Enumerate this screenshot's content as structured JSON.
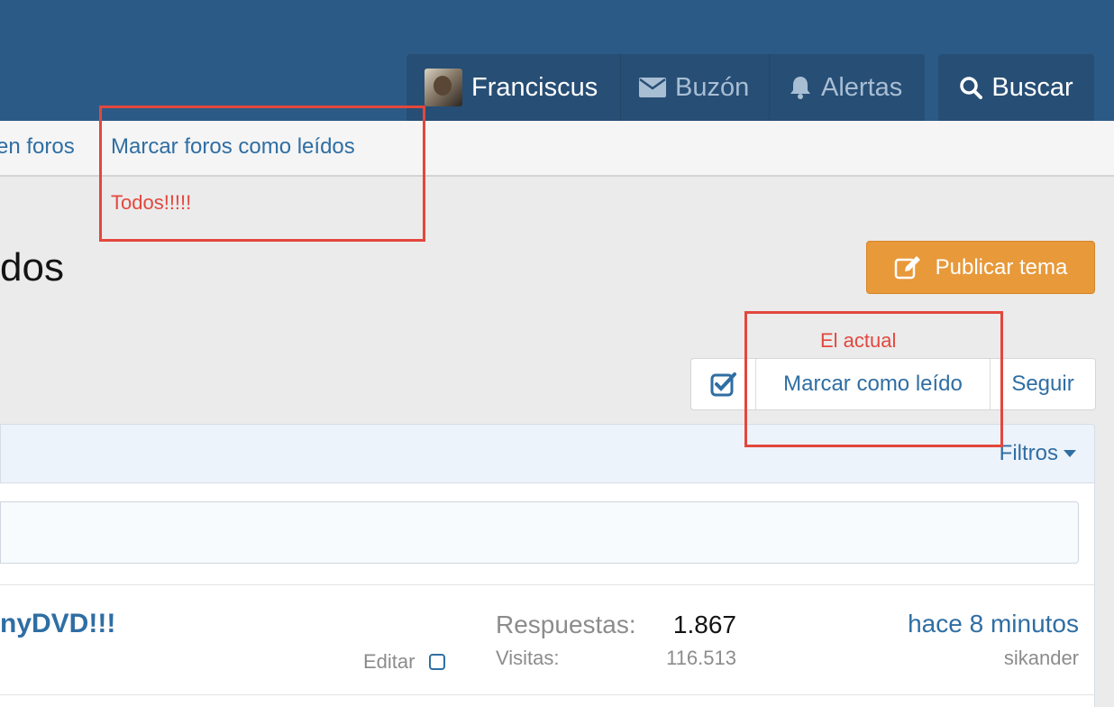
{
  "header": {
    "user": {
      "name": "Franciscus",
      "icon": "avatar"
    },
    "inbox": {
      "label": "Buzón",
      "icon": "envelope-icon"
    },
    "alerts": {
      "label": "Alertas",
      "icon": "bell-icon"
    },
    "search": {
      "label": "Buscar",
      "icon": "search-icon"
    }
  },
  "subnav": {
    "new_posts_partial": "en foros",
    "mark_forums_read": "Marcar foros como leídos"
  },
  "annotations": {
    "all_label": "Todos!!!!!",
    "current_label": "El actual",
    "color": "#e3473d"
  },
  "page": {
    "title_partial": "dos",
    "post_thread": "Publicar tema",
    "mark_read": "Marcar como leído",
    "follow": "Seguir",
    "filters": "Filtros"
  },
  "thread": {
    "title_partial": "nyDVD!!!",
    "edit_label": "Editar",
    "replies_label": "Respuestas:",
    "replies_value": "1.867",
    "views_label": "Visitas:",
    "views_value": "116.513",
    "last_time": "hace 8 minutos",
    "last_user": "sikander"
  },
  "colors": {
    "header_bg": "#2b5a86",
    "nav_tab_bg": "#274e75",
    "link": "#2f6ea3",
    "accent_button": "#e8993a"
  }
}
